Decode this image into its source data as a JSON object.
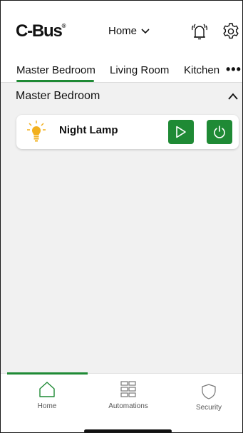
{
  "header": {
    "logo_text": "C-Bus",
    "logo_mark": "®",
    "location_select": "Home"
  },
  "tabs": [
    {
      "label": "Master Bedroom",
      "active": true
    },
    {
      "label": "Living Room",
      "active": false
    },
    {
      "label": "Kitchen",
      "active": false
    }
  ],
  "more_label": "•••",
  "room": {
    "title": "Master Bedroom",
    "devices": [
      {
        "name": "Night Lamp",
        "icon": "bulb-icon"
      }
    ]
  },
  "bottom_nav": [
    {
      "label": "Home",
      "icon": "home-icon",
      "active": true
    },
    {
      "label": "Automations",
      "icon": "grid-icon",
      "active": false
    },
    {
      "label": "Security",
      "icon": "shield-icon",
      "active": false
    }
  ],
  "colors": {
    "accent": "#1f8a35",
    "section_bg": "#f1f1f1",
    "bulb": "#f2b01e"
  }
}
